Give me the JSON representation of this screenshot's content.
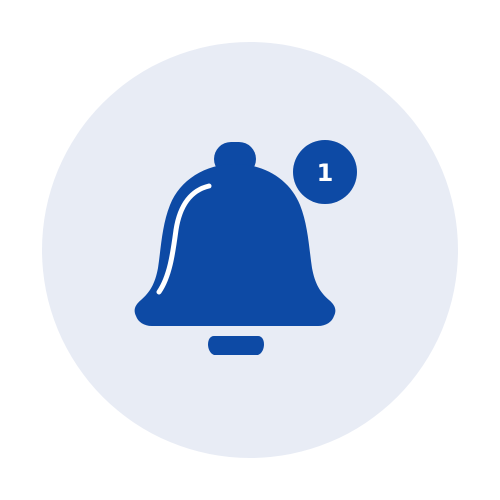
{
  "colors": {
    "background": "#ffffff",
    "circle": "#e8ecf5",
    "bell": "#0d4aa5",
    "highlight": "#ffffff",
    "badge": "#0d4aa5",
    "badge_text": "#ffffff"
  },
  "icon": {
    "name": "bell-icon",
    "badge": {
      "count": "1"
    }
  }
}
